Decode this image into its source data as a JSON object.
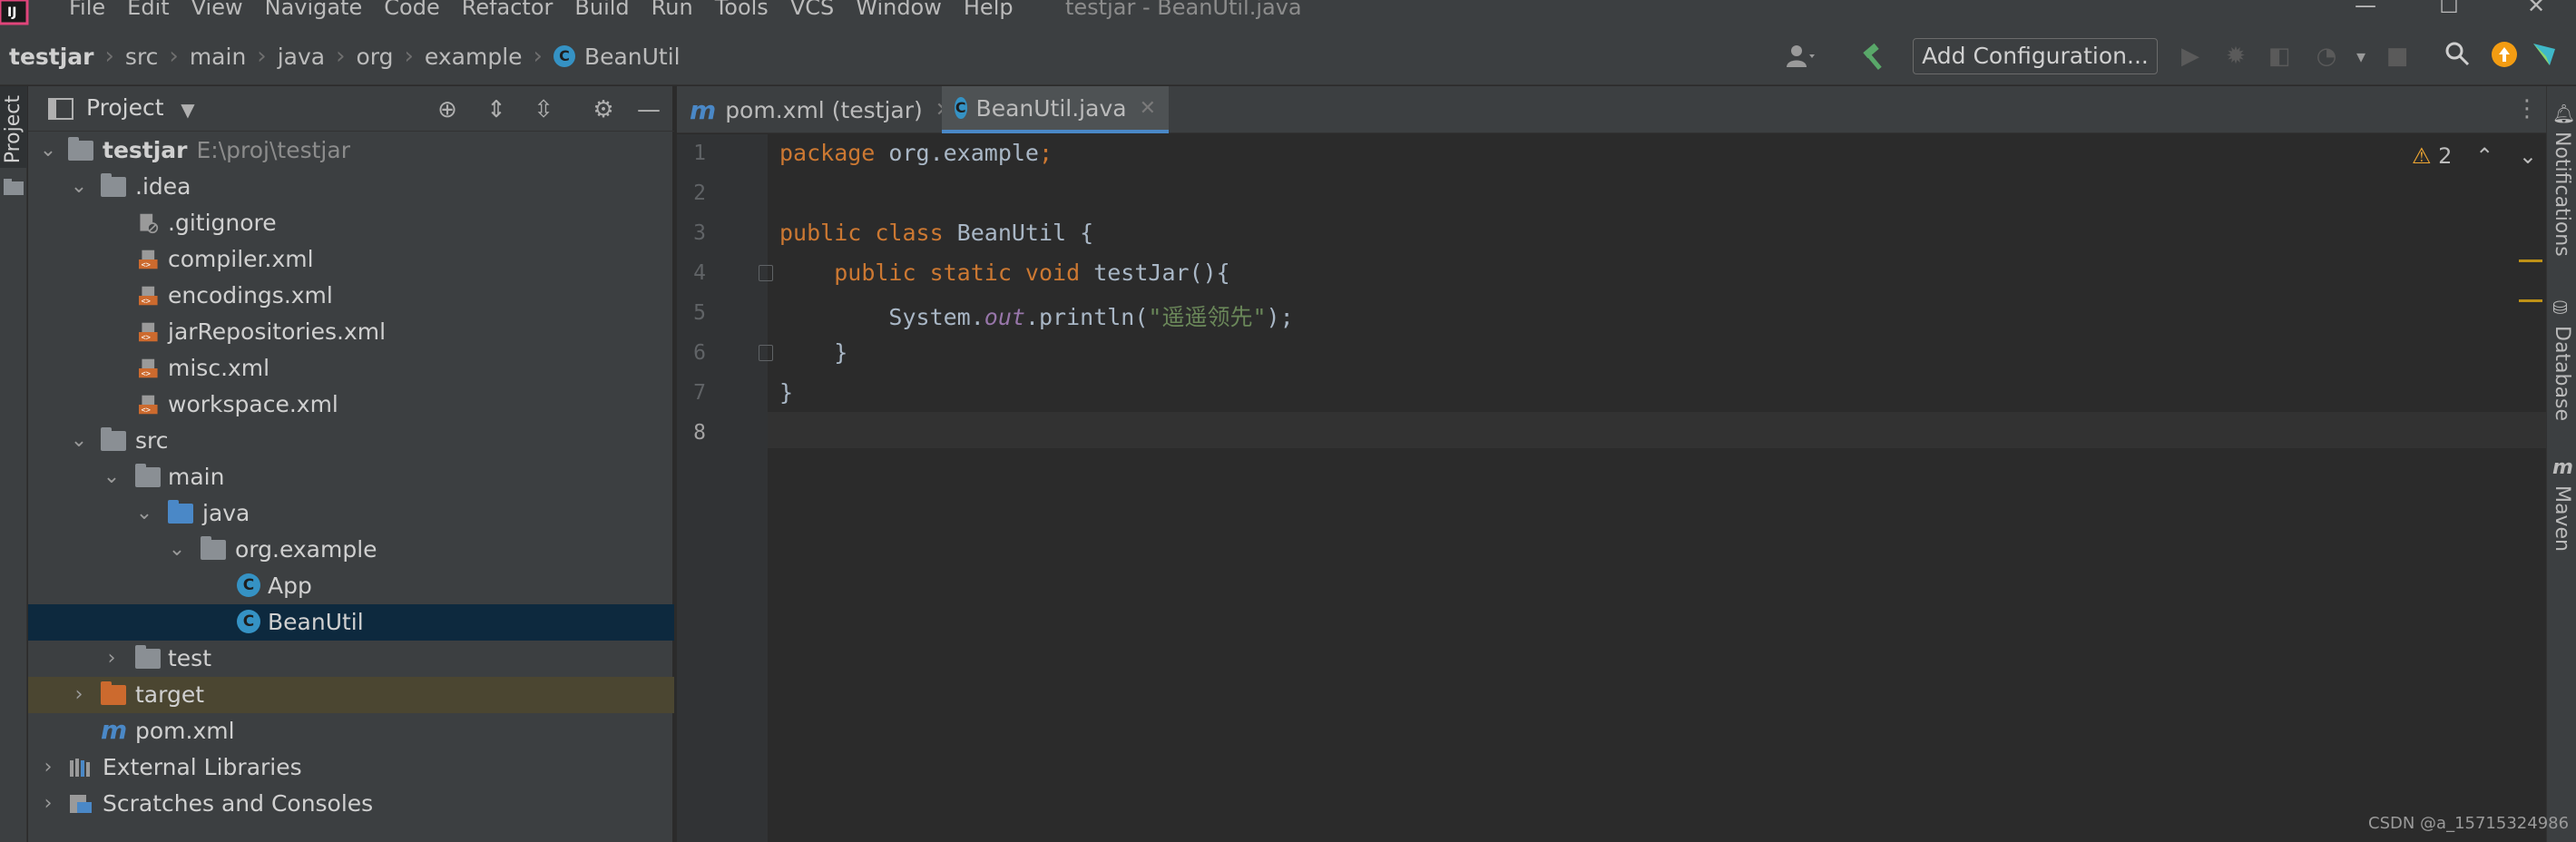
{
  "menubar": {
    "items": [
      {
        "label": "File"
      },
      {
        "label": "Edit"
      },
      {
        "label": "View"
      },
      {
        "label": "Navigate"
      },
      {
        "label": "Code"
      },
      {
        "label": "Refactor"
      },
      {
        "label": "Build"
      },
      {
        "label": "Run"
      },
      {
        "label": "Tools"
      },
      {
        "label": "VCS"
      },
      {
        "label": "Window"
      },
      {
        "label": "Help"
      }
    ],
    "window_title": "testjar - BeanUtil.java"
  },
  "navbar": {
    "breadcrumb": [
      "testjar",
      "src",
      "main",
      "java",
      "org",
      "example",
      "BeanUtil"
    ],
    "add_configuration": "Add Configuration..."
  },
  "left_strip": {
    "project_tab": "Project"
  },
  "project_panel": {
    "title": "Project",
    "tree": [
      {
        "label": "testjar",
        "path": "E:\\proj\\testjar"
      },
      {
        "label": ".idea"
      },
      {
        "label": ".gitignore"
      },
      {
        "label": "compiler.xml"
      },
      {
        "label": "encodings.xml"
      },
      {
        "label": "jarRepositories.xml"
      },
      {
        "label": "misc.xml"
      },
      {
        "label": "workspace.xml"
      },
      {
        "label": "src"
      },
      {
        "label": "main"
      },
      {
        "label": "java"
      },
      {
        "label": "org.example"
      },
      {
        "label": "App"
      },
      {
        "label": "BeanUtil"
      },
      {
        "label": "test"
      },
      {
        "label": "target"
      },
      {
        "label": "pom.xml"
      },
      {
        "label": "External Libraries"
      },
      {
        "label": "Scratches and Consoles"
      }
    ]
  },
  "tabs": [
    {
      "label": "pom.xml (testjar)",
      "icon": "maven-icon"
    },
    {
      "label": "BeanUtil.java",
      "icon": "java-class-icon",
      "active": true
    }
  ],
  "editor": {
    "line_numbers": [
      "1",
      "2",
      "3",
      "4",
      "5",
      "6",
      "7",
      "8"
    ],
    "code": {
      "l1_kw": "package",
      "l1_rest": " org.example",
      "l1_semi": ";",
      "l3_kw": "public class",
      "l3_name": " BeanUtil",
      "l3_rest": " {",
      "l4_indent": "    ",
      "l4_kw": "public static void",
      "l4_name": " testJar",
      "l4_rest": "(){",
      "l5_indent": "        ",
      "l5_a": "System.",
      "l5_field": "out",
      "l5_b": ".println(",
      "l5_str": "\"遥遥领先\"",
      "l5_c": ");",
      "l6": "    }",
      "l7": "}"
    },
    "warnings_count": "2"
  },
  "right_strip": {
    "notifications": "Notifications",
    "database": "Database",
    "maven": "Maven"
  },
  "watermark": "CSDN @a_15715324986",
  "colors": {
    "keyword": "#cc7832",
    "string": "#6a8759",
    "field": "#9876aa",
    "accent": "#4a88c7",
    "selection": "#0d293e"
  }
}
